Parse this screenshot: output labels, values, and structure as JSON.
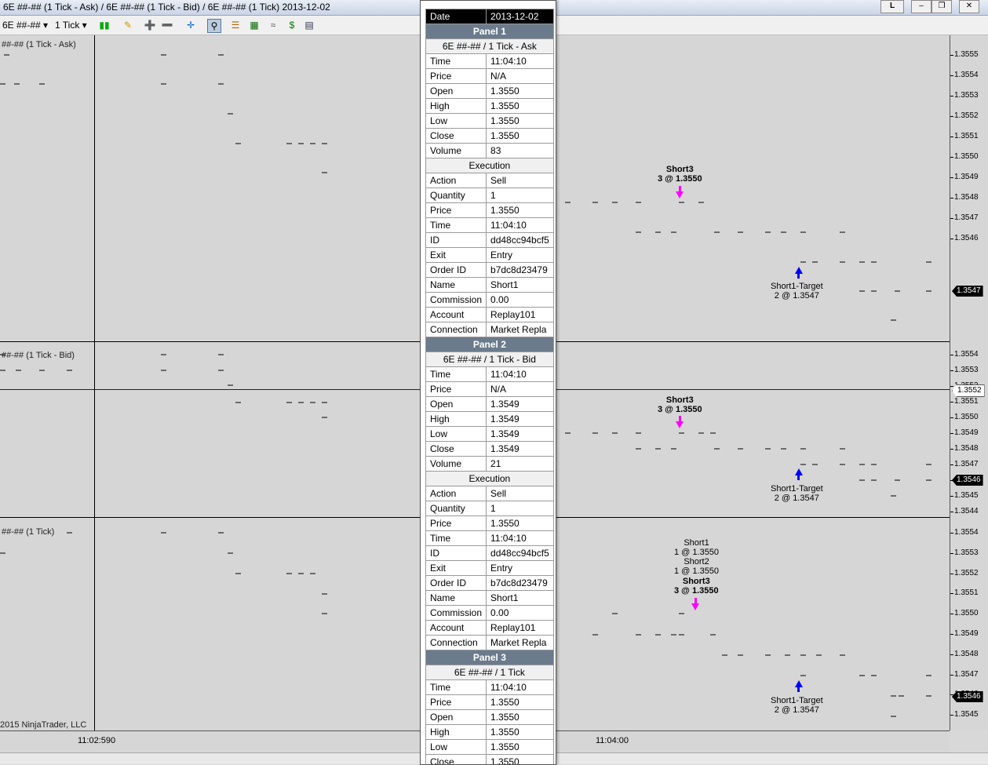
{
  "window": {
    "title": "6E ##-## (1 Tick - Ask) / 6E ##-## (1 Tick - Bid) / 6E ##-## (1 Tick)  2013-12-02"
  },
  "toolbar": {
    "instrument": "6E ##-##",
    "interval": "1 Tick"
  },
  "panels": [
    {
      "label": "##-## (1 Tick - Ask)",
      "ticks": [
        "1.3555",
        "1.3554",
        "1.3553",
        "1.3552",
        "1.3551",
        "1.3550",
        "1.3549",
        "1.3548",
        "1.3547",
        "1.3546"
      ],
      "last_price": "1.3547"
    },
    {
      "label": "##-## (1 Tick - Bid)",
      "ticks": [
        "1.3554",
        "1.3553",
        "1.3552",
        "1.3551",
        "1.3550",
        "1.3549",
        "1.3548",
        "1.3547",
        "1.3546",
        "1.3545",
        "1.3544"
      ],
      "last_price": "1.3546",
      "marker_price": "1.3552"
    },
    {
      "label": "##-## (1 Tick)",
      "ticks": [
        "1.3554",
        "1.3553",
        "1.3552",
        "1.3551",
        "1.3550",
        "1.3549",
        "1.3548",
        "1.3547",
        "1.3546",
        "1.3545"
      ],
      "last_price": "1.3546"
    }
  ],
  "executions": {
    "p1_short": {
      "name": "Short3",
      "qty": "3 @ 1.3550"
    },
    "p1_target": {
      "name": "Short1-Target",
      "qty": "2 @ 1.3547"
    },
    "p2_short": {
      "name": "Short3",
      "qty": "3 @ 1.3550"
    },
    "p2_target": {
      "name": "Short1-Target",
      "qty": "2 @ 1.3547"
    },
    "p3_s1": {
      "name": "Short1",
      "qty": "1 @ 1.3550"
    },
    "p3_s2": {
      "name": "Short2",
      "qty": "1 @ 1.3550"
    },
    "p3_s3": {
      "name": "Short3",
      "qty": "3 @ 1.3550"
    },
    "p3_target": {
      "name": "Short1-Target",
      "qty": "2 @ 1.3547"
    }
  },
  "xaxis": {
    "t1": "11:02:590",
    "t2": "11:04:00"
  },
  "copyright": "2015 NinjaTrader, LLC",
  "databox": {
    "date_key": "Date",
    "date_val": "2013-12-02",
    "sections": [
      {
        "panel": "Panel 1",
        "series": "6E ##-## / 1 Tick - Ask",
        "bar": [
          [
            "Time",
            "11:04:10"
          ],
          [
            "Price",
            "N/A"
          ],
          [
            "Open",
            "1.3550"
          ],
          [
            "High",
            "1.3550"
          ],
          [
            "Low",
            "1.3550"
          ],
          [
            "Close",
            "1.3550"
          ],
          [
            "Volume",
            "83"
          ]
        ],
        "exec_title": "Execution",
        "exec": [
          [
            "Action",
            "Sell"
          ],
          [
            "Quantity",
            "1"
          ],
          [
            "Price",
            "1.3550"
          ],
          [
            "Time",
            "11:04:10"
          ],
          [
            "ID",
            "dd48cc94bcf5"
          ],
          [
            "Exit",
            "Entry"
          ],
          [
            "Order ID",
            "b7dc8d23479"
          ],
          [
            "Name",
            "Short1"
          ],
          [
            "Commission",
            "0.00"
          ],
          [
            "Account",
            "Replay101"
          ],
          [
            "Connection",
            "Market Repla"
          ]
        ]
      },
      {
        "panel": "Panel 2",
        "series": "6E ##-## / 1 Tick - Bid",
        "bar": [
          [
            "Time",
            "11:04:10"
          ],
          [
            "Price",
            "N/A"
          ],
          [
            "Open",
            "1.3549"
          ],
          [
            "High",
            "1.3549"
          ],
          [
            "Low",
            "1.3549"
          ],
          [
            "Close",
            "1.3549"
          ],
          [
            "Volume",
            "21"
          ]
        ],
        "exec_title": "Execution",
        "exec": [
          [
            "Action",
            "Sell"
          ],
          [
            "Quantity",
            "1"
          ],
          [
            "Price",
            "1.3550"
          ],
          [
            "Time",
            "11:04:10"
          ],
          [
            "ID",
            "dd48cc94bcf5"
          ],
          [
            "Exit",
            "Entry"
          ],
          [
            "Order ID",
            "b7dc8d23479"
          ],
          [
            "Name",
            "Short1"
          ],
          [
            "Commission",
            "0.00"
          ],
          [
            "Account",
            "Replay101"
          ],
          [
            "Connection",
            "Market Repla"
          ]
        ]
      },
      {
        "panel": "Panel 3",
        "series": "6E ##-## / 1 Tick",
        "bar": [
          [
            "Time",
            "11:04:10"
          ],
          [
            "Price",
            "1.3550"
          ],
          [
            "Open",
            "1.3550"
          ],
          [
            "High",
            "1.3550"
          ],
          [
            "Low",
            "1.3550"
          ],
          [
            "Close",
            "1.3550"
          ]
        ]
      }
    ]
  }
}
